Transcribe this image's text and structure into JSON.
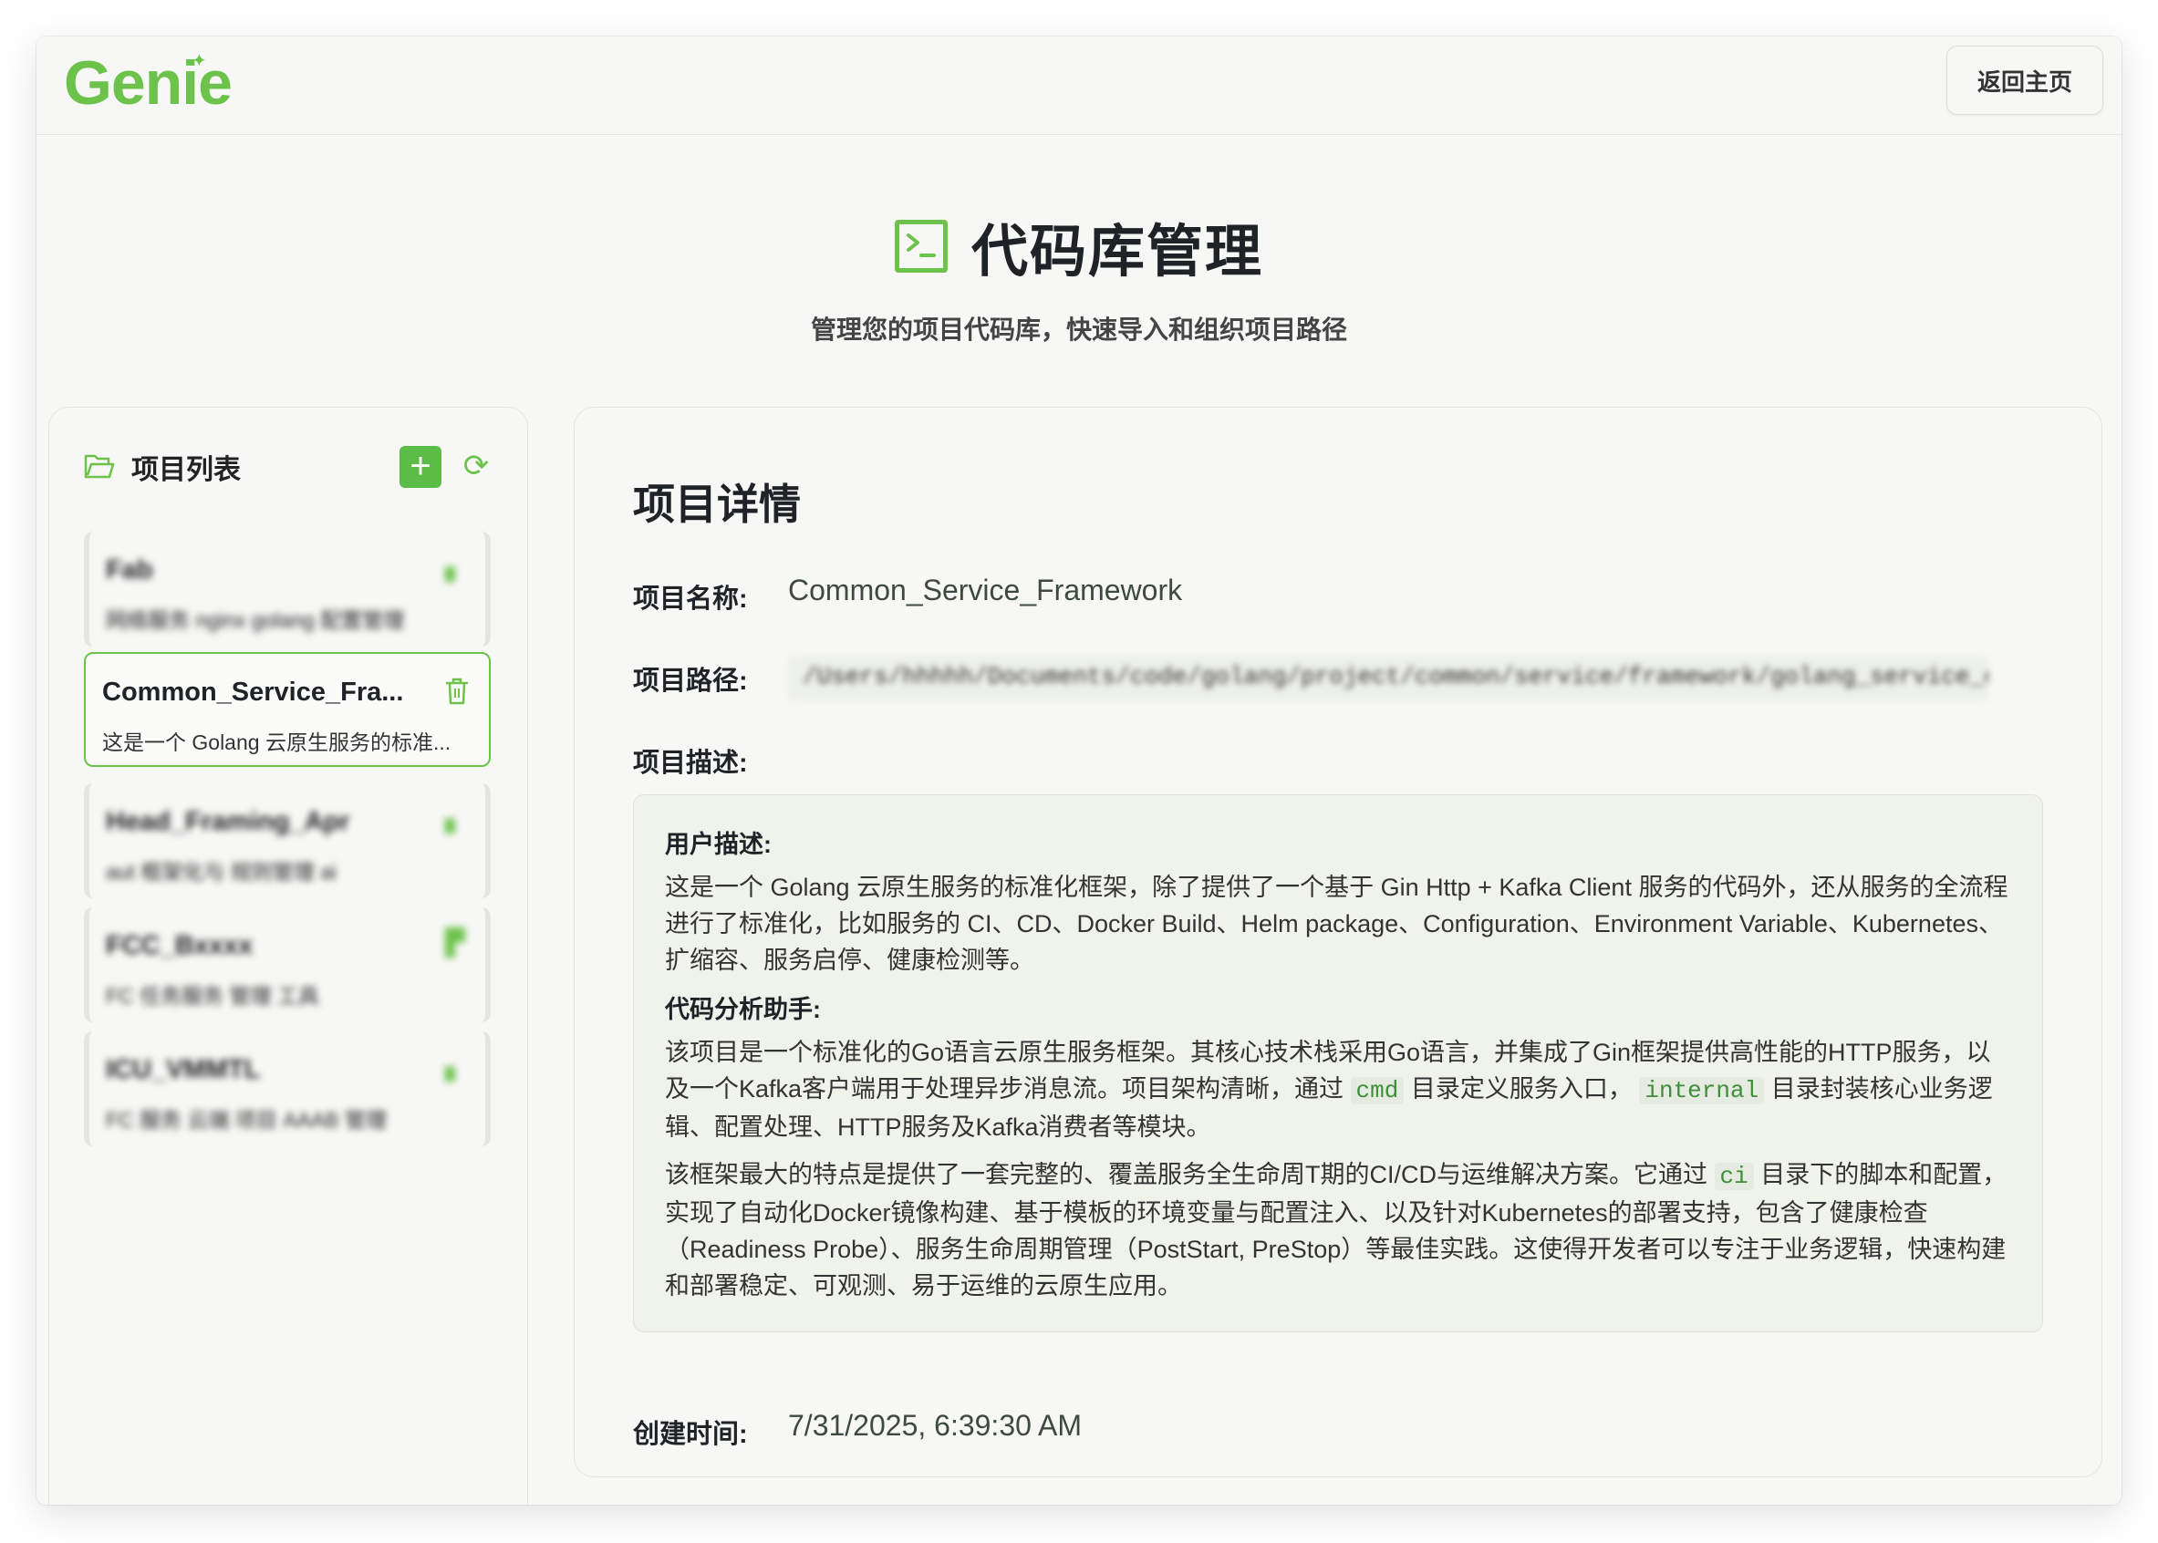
{
  "app": {
    "logo": "Genie",
    "home_button": "返回主页"
  },
  "hero": {
    "title": "代码库管理",
    "subtitle": "管理您的项目代码库，快速导入和组织项目路径"
  },
  "sidebar": {
    "title": "项目列表",
    "add_label": "+",
    "refresh_label": "⟳",
    "projects": [
      {
        "name": "Fab",
        "desc": "网络服务 nginx golang 配置管理",
        "blurred": true
      },
      {
        "name": "Common_Service_Fra...",
        "desc": "这是一个 Golang 云原生服务的标准...",
        "blurred": false
      },
      {
        "name": "Head_Framing_Apr",
        "desc": "aut 框架化与 规则管理 ai",
        "blurred": true
      },
      {
        "name": "FCC_Bxxxx",
        "desc": "FC 任务服务 管理 工具",
        "blurred": true
      },
      {
        "name": "ICU_VMMTL",
        "desc": "FC 服务 云端 项目 AAAB 管理",
        "blurred": true
      }
    ]
  },
  "detail": {
    "title": "项目详情",
    "name_label": "项目名称:",
    "name_value": "Common_Service_Framework",
    "path_label": "项目路径:",
    "path_value": "/Users/hhhhh/Documents/code/golang/project/common/service/framework/golang_service_cmd_rmm",
    "desc_label": "项目描述:",
    "user_desc_heading": "用户描述:",
    "user_desc_text": "这是一个 Golang 云原生服务的标准化框架，除了提供了一个基于 Gin Http + Kafka Client 服务的代码外，还从服务的全流程进行了标准化，比如服务的 CI、CD、Docker Build、Helm package、Configuration、Environment Variable、Kubernetes、扩缩容、服务启停、健康检测等。",
    "assistant_heading": "代码分析助手:",
    "assistant_p1_a": "该项目是一个标准化的Go语言云原生服务框架。其核心技术栈采用Go语言，并集成了Gin框架提供高性能的HTTP服务，以及一个Kafka客户端用于处理异步消息流。项目架构清晰，通过 ",
    "assistant_p1_code1": "cmd",
    "assistant_p1_b": " 目录定义服务入口， ",
    "assistant_p1_code2": "internal",
    "assistant_p1_c": " 目录封装核心业务逻辑、配置处理、HTTP服务及Kafka消费者等模块。",
    "assistant_p2_a": "该框架最大的特点是提供了一套完整的、覆盖服务全生命周T期的CI/CD与运维解决方案。它通过 ",
    "assistant_p2_code": "ci",
    "assistant_p2_b": " 目录下的脚本和配置，实现了自动化Docker镜像构建、基于模板的环境变量与配置注入、以及针对Kubernetes的部署支持，包含了健康检查（Readiness Probe）、服务生命周期管理（PostStart, PreStop）等最佳实践。这使得开发者可以专注于业务逻辑，快速构建和部署稳定、可观测、易于运维的云原生应用。",
    "created_label": "创建时间:",
    "created_value": "7/31/2025, 6:39:30 AM"
  },
  "colors": {
    "accent": "#6cc24a",
    "background": "#f7f8f6"
  }
}
